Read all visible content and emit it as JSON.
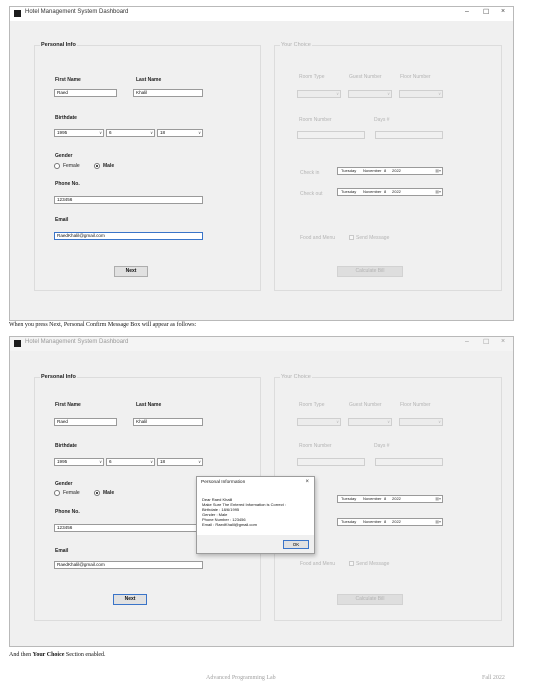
{
  "window": {
    "title": "Hotel Management System Dashboard",
    "controls": {
      "minimize": "–",
      "maximize": "☐",
      "close": "×"
    }
  },
  "personal": {
    "group_label": "Personal Info",
    "first_name_label": "First Name",
    "last_name_label": "Last Name",
    "first_name": "Raed",
    "last_name": "Khalil",
    "birthdate_label": "Birthdate",
    "year": "1995",
    "month": "6",
    "day": "18",
    "gender_label": "Gender",
    "female_label": "Female",
    "male_label": "Male",
    "phone_label": "Phone No.",
    "phone": "123456",
    "email_label": "Email",
    "email": "RaedKhalil@gmail.com",
    "next_label": "Next"
  },
  "choice": {
    "group_label": "Your Choice",
    "room_type_label": "Room Type",
    "guest_number_label": "Guest Number",
    "floor_number_label": "Floor Number",
    "room_number_label": "Room Number",
    "days_label": "Days #",
    "check_in_label": "Check in",
    "check_out_label": "Check out",
    "check_in_date": {
      "weekday": "Tuesday",
      "month": "November",
      "day": "8",
      "year": "2022"
    },
    "check_out_date": {
      "weekday": "Tuesday",
      "month": "November",
      "day": "8",
      "year": "2022"
    },
    "food_label": "Food and Menu",
    "send_message_label": "Send Message",
    "calculate_label": "Calculate Bill"
  },
  "caption_1": "When you press Next, Personal Confirm Message Box will appear as follows:",
  "caption_2_prefix": "And then ",
  "caption_2_bold": "Your Choice",
  "caption_2_suffix": " Section enabled.",
  "messagebox": {
    "title": "Personal Information",
    "close": "×",
    "lines": [
      "Dear Raed Khalil",
      "Make Sure The Entered Information is Correct :",
      "Birthdate : 18/6/1995",
      "Gender : Male",
      "Phone Number : 123456",
      "Email : RaedKhalil@gmail.com"
    ],
    "ok_label": "OK"
  },
  "footer": {
    "course": "Advanced Programming Lab",
    "term": "Fall 2022"
  }
}
